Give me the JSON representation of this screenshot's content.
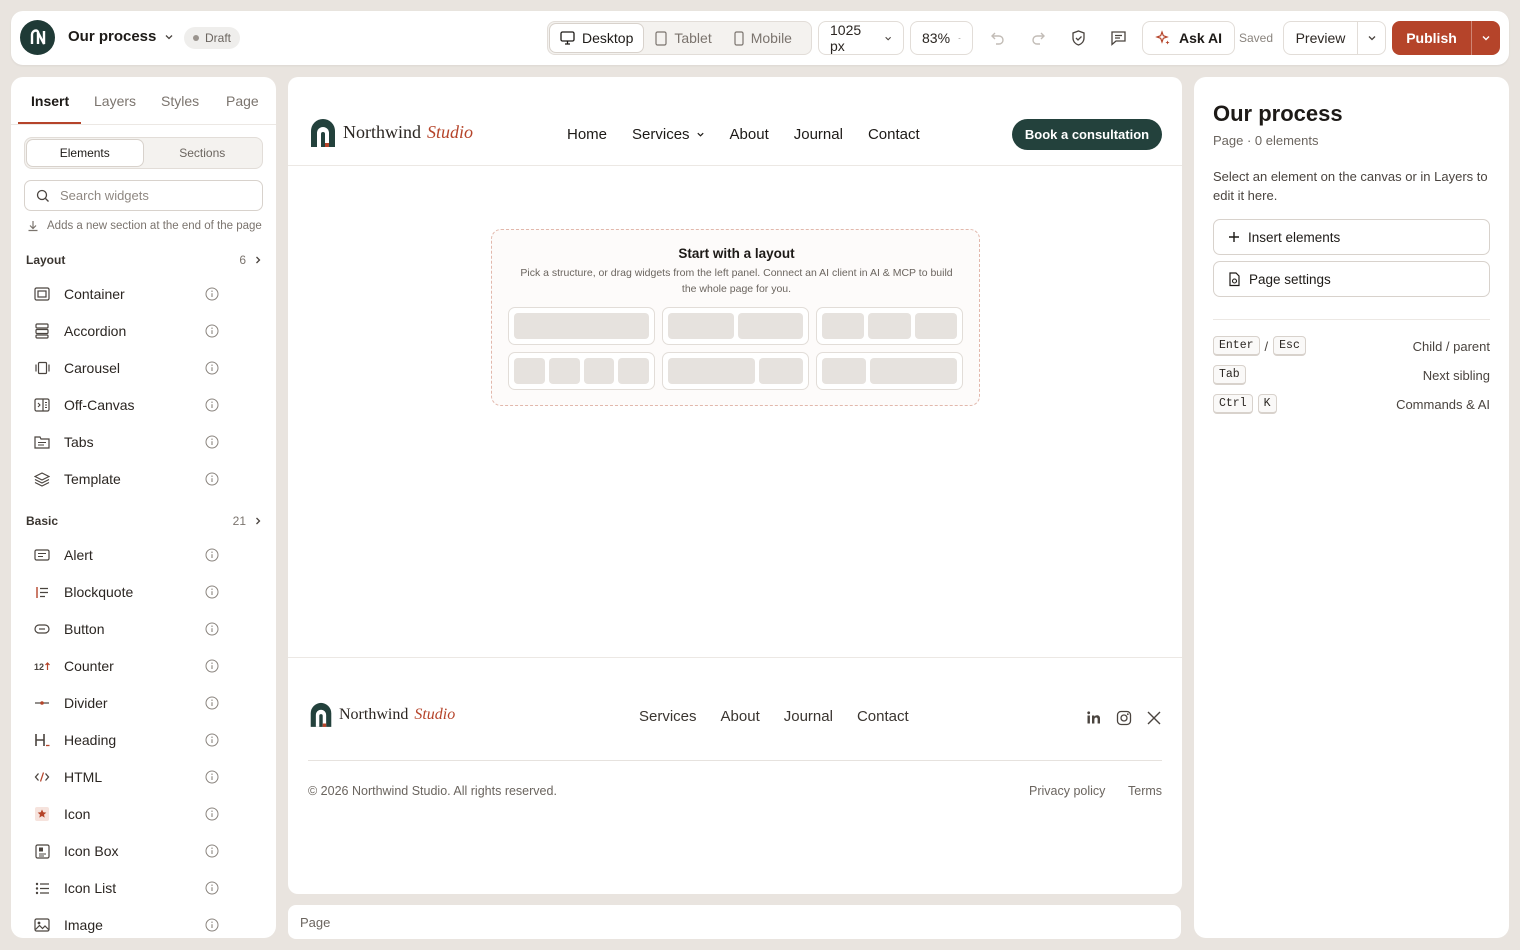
{
  "topbar": {
    "page_title": "Our process",
    "status": "Draft",
    "devices": [
      {
        "label": "Desktop",
        "icon": "monitor-icon",
        "active": true
      },
      {
        "label": "Tablet",
        "icon": "tablet-icon",
        "active": false
      },
      {
        "label": "Mobile",
        "icon": "mobile-icon",
        "active": false
      }
    ],
    "width_value": "1025 px",
    "zoom_value": "83%",
    "ask_ai": "Ask AI",
    "save_status": "Saved",
    "preview": "Preview",
    "publish": "Publish",
    "accent": "#b5442a"
  },
  "left_panel": {
    "tabs": [
      "Insert",
      "Layers",
      "Styles",
      "Page"
    ],
    "active_tab": "Insert",
    "segments": [
      "Elements",
      "Sections"
    ],
    "search_placeholder": "Search widgets",
    "hint": "Adds a new section at the end of the page",
    "categories": [
      {
        "name": "Layout",
        "count": "6",
        "items": [
          {
            "label": "Container",
            "icon": "container-icon"
          },
          {
            "label": "Accordion",
            "icon": "accordion-icon"
          },
          {
            "label": "Carousel",
            "icon": "carousel-icon"
          },
          {
            "label": "Off-Canvas",
            "icon": "off-canvas-icon"
          },
          {
            "label": "Tabs",
            "icon": "tabs-icon"
          },
          {
            "label": "Template",
            "icon": "template-icon"
          }
        ]
      },
      {
        "name": "Basic",
        "count": "21",
        "items": [
          {
            "label": "Alert",
            "icon": "alert-icon"
          },
          {
            "label": "Blockquote",
            "icon": "blockquote-icon"
          },
          {
            "label": "Button",
            "icon": "button-icon"
          },
          {
            "label": "Counter",
            "icon": "counter-icon"
          },
          {
            "label": "Divider",
            "icon": "divider-icon"
          },
          {
            "label": "Heading",
            "icon": "heading-icon"
          },
          {
            "label": "HTML",
            "icon": "html-icon"
          },
          {
            "label": "Icon",
            "icon": "star-icon"
          },
          {
            "label": "Icon Box",
            "icon": "icon-box-icon"
          },
          {
            "label": "Icon List",
            "icon": "icon-list-icon"
          },
          {
            "label": "Image",
            "icon": "image-icon"
          }
        ]
      }
    ]
  },
  "canvas": {
    "brand_name": "Northwind",
    "brand_accent": "Studio",
    "nav": [
      "Home",
      "Services",
      "About",
      "Journal",
      "Contact"
    ],
    "cta": "Book a consultation",
    "layout_title": "Start with a layout",
    "layout_sub": "Pick a structure, or drag widgets from the left panel. Connect an AI client in AI & MCP to build the whole page for you.",
    "footer_nav": [
      "Services",
      "About",
      "Journal",
      "Contact"
    ],
    "social": [
      "linkedin-icon",
      "instagram-icon",
      "x-icon"
    ],
    "copyright": "© 2026 Northwind Studio. All rights reserved.",
    "legal": [
      "Privacy policy",
      "Terms"
    ]
  },
  "breadcrumb": "Page",
  "right_panel": {
    "title": "Our process",
    "meta": "Page · 0 elements",
    "desc": "Select an element on the canvas or in Layers to edit it here.",
    "insert": "Insert elements",
    "settings": "Page settings",
    "shortcuts": [
      {
        "keys": [
          "Enter",
          "Esc"
        ],
        "sep": "/",
        "desc": "Child / parent"
      },
      {
        "keys": [
          "Tab"
        ],
        "sep": "",
        "desc": "Next sibling"
      },
      {
        "keys": [
          "Ctrl",
          "K"
        ],
        "sep": "",
        "desc": "Commands & AI"
      }
    ]
  }
}
